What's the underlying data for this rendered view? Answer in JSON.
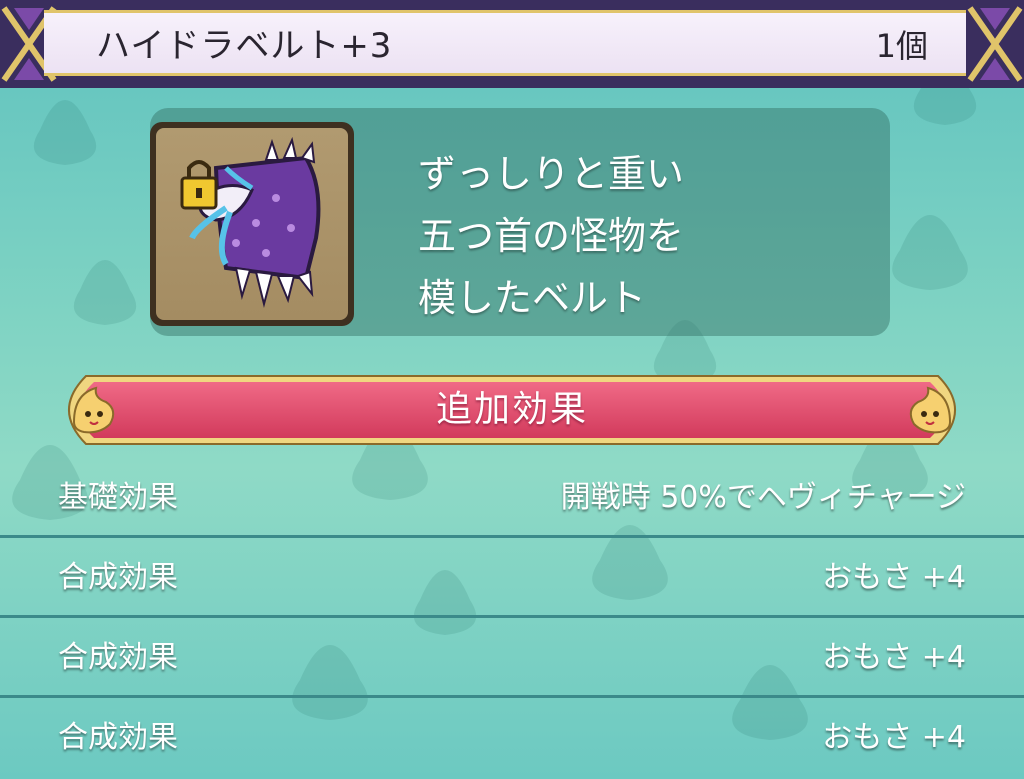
{
  "header": {
    "title": "ハイドラベルト+3",
    "count": "1個"
  },
  "item": {
    "icon": "hydra-belt-icon",
    "description": [
      "ずっしりと重い",
      "五つ首の怪物を",
      "模したベルト"
    ]
  },
  "banner": {
    "label": "追加効果",
    "color": "#e0506e",
    "icon": "slime-face-icon"
  },
  "effects": [
    {
      "label": "基礎効果",
      "value": "開戦時 50%でヘヴィチャージ"
    },
    {
      "label": "合成効果",
      "value": "おもさ +4"
    },
    {
      "label": "合成効果",
      "value": "おもさ +4"
    },
    {
      "label": "合成効果",
      "value": "おもさ +4"
    }
  ],
  "colors": {
    "header_bg": "#3a2e5e",
    "gold_trim": "#e0c46a",
    "background": "#7fd3c3"
  }
}
